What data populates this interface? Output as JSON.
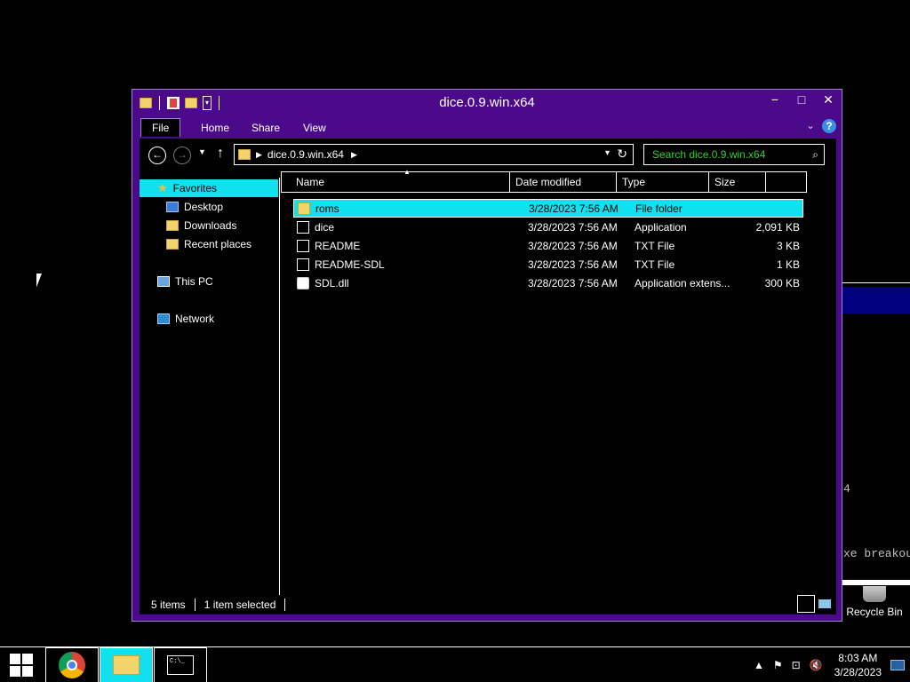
{
  "window": {
    "title": "dice.0.9.win.x64",
    "controls": {
      "minimize": "−",
      "maximize": "□",
      "close": "✕"
    }
  },
  "ribbon": {
    "tabs": [
      "File",
      "Home",
      "Share",
      "View"
    ],
    "help": "?"
  },
  "address": {
    "path": "dice.0.9.win.x64",
    "search_placeholder": "Search dice.0.9.win.x64"
  },
  "navpane": {
    "favorites": "Favorites",
    "desktop": "Desktop",
    "downloads": "Downloads",
    "recent_places": "Recent places",
    "this_pc": "This PC",
    "network": "Network"
  },
  "columns": {
    "name": "Name",
    "date": "Date modified",
    "type": "Type",
    "size": "Size"
  },
  "files": [
    {
      "name": "roms",
      "date": "3/28/2023 7:56 AM",
      "type": "File folder",
      "size": "",
      "icon": "folder-icon"
    },
    {
      "name": "dice",
      "date": "3/28/2023 7:56 AM",
      "type": "Application",
      "size": "2,091 KB",
      "icon": "application-icon"
    },
    {
      "name": "README",
      "date": "3/28/2023 7:56 AM",
      "type": "TXT File",
      "size": "3 KB",
      "icon": "text-file-icon"
    },
    {
      "name": "README-SDL",
      "date": "3/28/2023 7:56 AM",
      "type": "TXT File",
      "size": "1 KB",
      "icon": "text-file-icon"
    },
    {
      "name": "SDL.dll",
      "date": "3/28/2023 7:56 AM",
      "type": "Application extens...",
      "size": "300 KB",
      "icon": "dll-icon"
    }
  ],
  "status": {
    "count": "5 items",
    "selected": "1 item selected"
  },
  "console": {
    "line1": "4",
    "line2": "xe breakou"
  },
  "desktop": {
    "recycle_bin": "Recycle Bin"
  },
  "taskbar": {
    "time": "8:03 AM",
    "date": "3/28/2023"
  },
  "colors": {
    "accent": "#4b0a8a",
    "selection": "#11e1ee",
    "search_text": "#2fd12f"
  }
}
